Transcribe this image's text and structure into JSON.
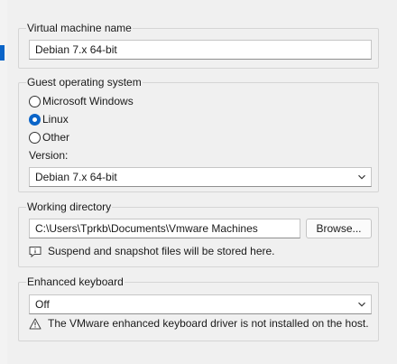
{
  "vm_name": {
    "legend": "Virtual machine name",
    "value": "Debian 7.x 64-bit"
  },
  "guest_os": {
    "legend": "Guest operating system",
    "options": [
      {
        "label": "Microsoft Windows",
        "checked": false
      },
      {
        "label": "Linux",
        "checked": true
      },
      {
        "label": "Other",
        "checked": false
      }
    ],
    "version_label": "Version:",
    "version_value": "Debian 7.x 64-bit"
  },
  "working_directory": {
    "legend": "Working directory",
    "path": "C:\\Users\\Tprkb\\Documents\\Vmware Machines",
    "browse_label": "Browse...",
    "note": "Suspend and snapshot files will be stored here."
  },
  "enhanced_keyboard": {
    "legend": "Enhanced keyboard",
    "value": "Off",
    "warning": "The VMware enhanced keyboard driver is not installed on the host."
  },
  "icons": {
    "combo_arrow": "chevron-down-icon",
    "info": "info-icon",
    "warning": "warning-icon"
  },
  "colors": {
    "accent": "#0a64c8",
    "panel_bg": "#f0f0f0"
  }
}
